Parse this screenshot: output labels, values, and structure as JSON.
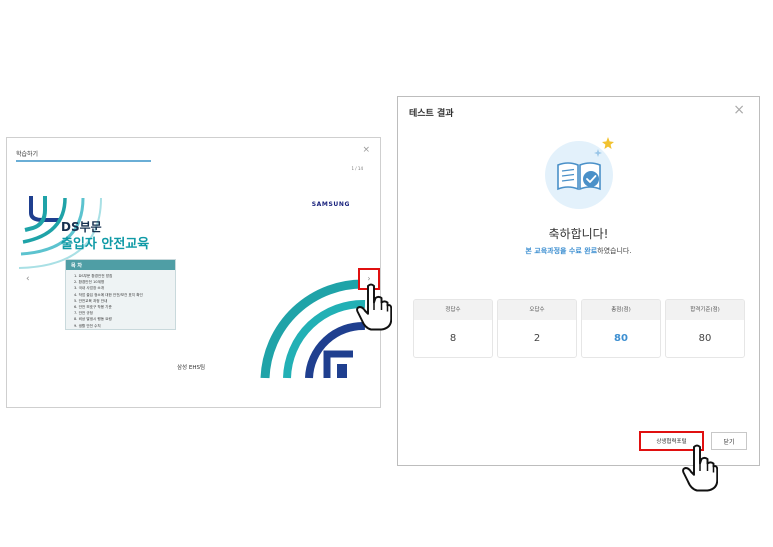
{
  "learning_window": {
    "title": "학습하기",
    "close_glyph": "×",
    "page_indicator": "1 / 14",
    "brand": "SAMSUNG",
    "slide_title_line1": "DS부문",
    "slide_title_line2": "출입자 안전교육",
    "toc": {
      "heading": "목 차",
      "items": [
        "1. DS부문 환경안전 방침",
        "2. 환경안전 10계명",
        "3. 국내 사업장 소개",
        "4. 작업 출입 정소에 대한 안전/보건 표지 확인",
        "5. 안전교육 과정 안내",
        "6. 안전 보호구 착용 기준",
        "7. 안전 규정",
        "8. 비상 발생시 행동 요령",
        "9. 생활 안전 수칙"
      ]
    },
    "prev_glyph": "‹",
    "next_glyph": "›",
    "team_label": "삼성 EHS팀"
  },
  "result_dialog": {
    "title": "테스트 결과",
    "close_glyph": "×",
    "congrats": "축하합니다!",
    "complete_highlight": "본 교육과정을 수료 완료",
    "complete_rest": "하였습니다.",
    "scores": [
      {
        "label": "정답수",
        "value": "8"
      },
      {
        "label": "오답수",
        "value": "2"
      },
      {
        "label": "총점(점)",
        "value": "80"
      },
      {
        "label": "합격기준(점)",
        "value": "80"
      }
    ],
    "portal_button": "상생협력포털",
    "close_button": "닫기"
  },
  "colors": {
    "highlight_box": "#e01010",
    "accent_blue": "#3d8fd1",
    "teal": "#1fa3a8",
    "navy": "#1f3f8f"
  },
  "icons": [
    "open-book-icon",
    "checkmark-icon",
    "star-icon",
    "pointer-hand-icon"
  ]
}
